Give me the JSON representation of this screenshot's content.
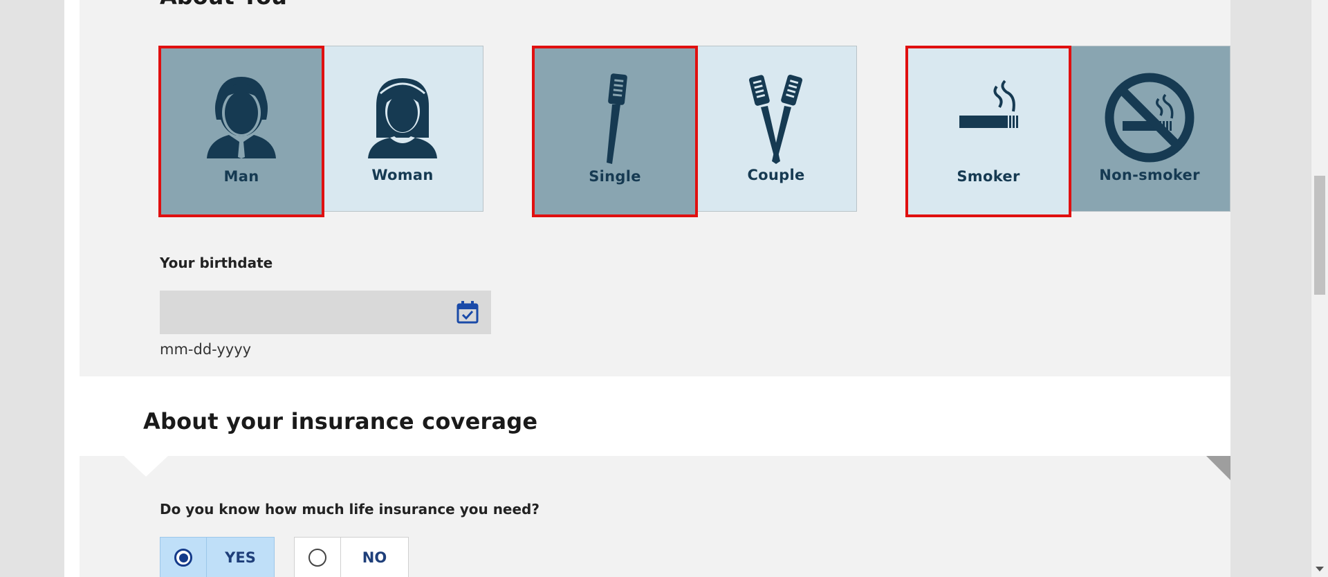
{
  "sections": {
    "about_you_title": "About You",
    "coverage_title": "About your insurance coverage"
  },
  "tiles": {
    "man": "Man",
    "woman": "Woman",
    "single": "Single",
    "couple": "Couple",
    "smoker": "Smoker",
    "non_smoker": "Non-smoker"
  },
  "selected": [
    "Man",
    "Single",
    "Smoker"
  ],
  "birthdate": {
    "label": "Your birthdate",
    "value": "",
    "hint": "mm-dd-yyyy"
  },
  "insurance_question": {
    "text": "Do you know how much life insurance you need?",
    "yes_label": "YES",
    "no_label": "NO",
    "selected": "YES"
  },
  "colors": {
    "selected_outline": "#e01010",
    "tile_dark": "#89a5b1",
    "tile_light": "#d9e8f0",
    "icon_color": "#163a52",
    "radio_selected_bg": "#bfdff8",
    "calendar_icon": "#1a4aa8"
  },
  "icons": {
    "man": "man-icon",
    "woman": "woman-icon",
    "single": "toothbrush-icon",
    "couple": "two-toothbrushes-icon",
    "smoker": "cigarette-icon",
    "non_smoker": "no-smoking-icon",
    "calendar": "calendar-check-icon"
  }
}
